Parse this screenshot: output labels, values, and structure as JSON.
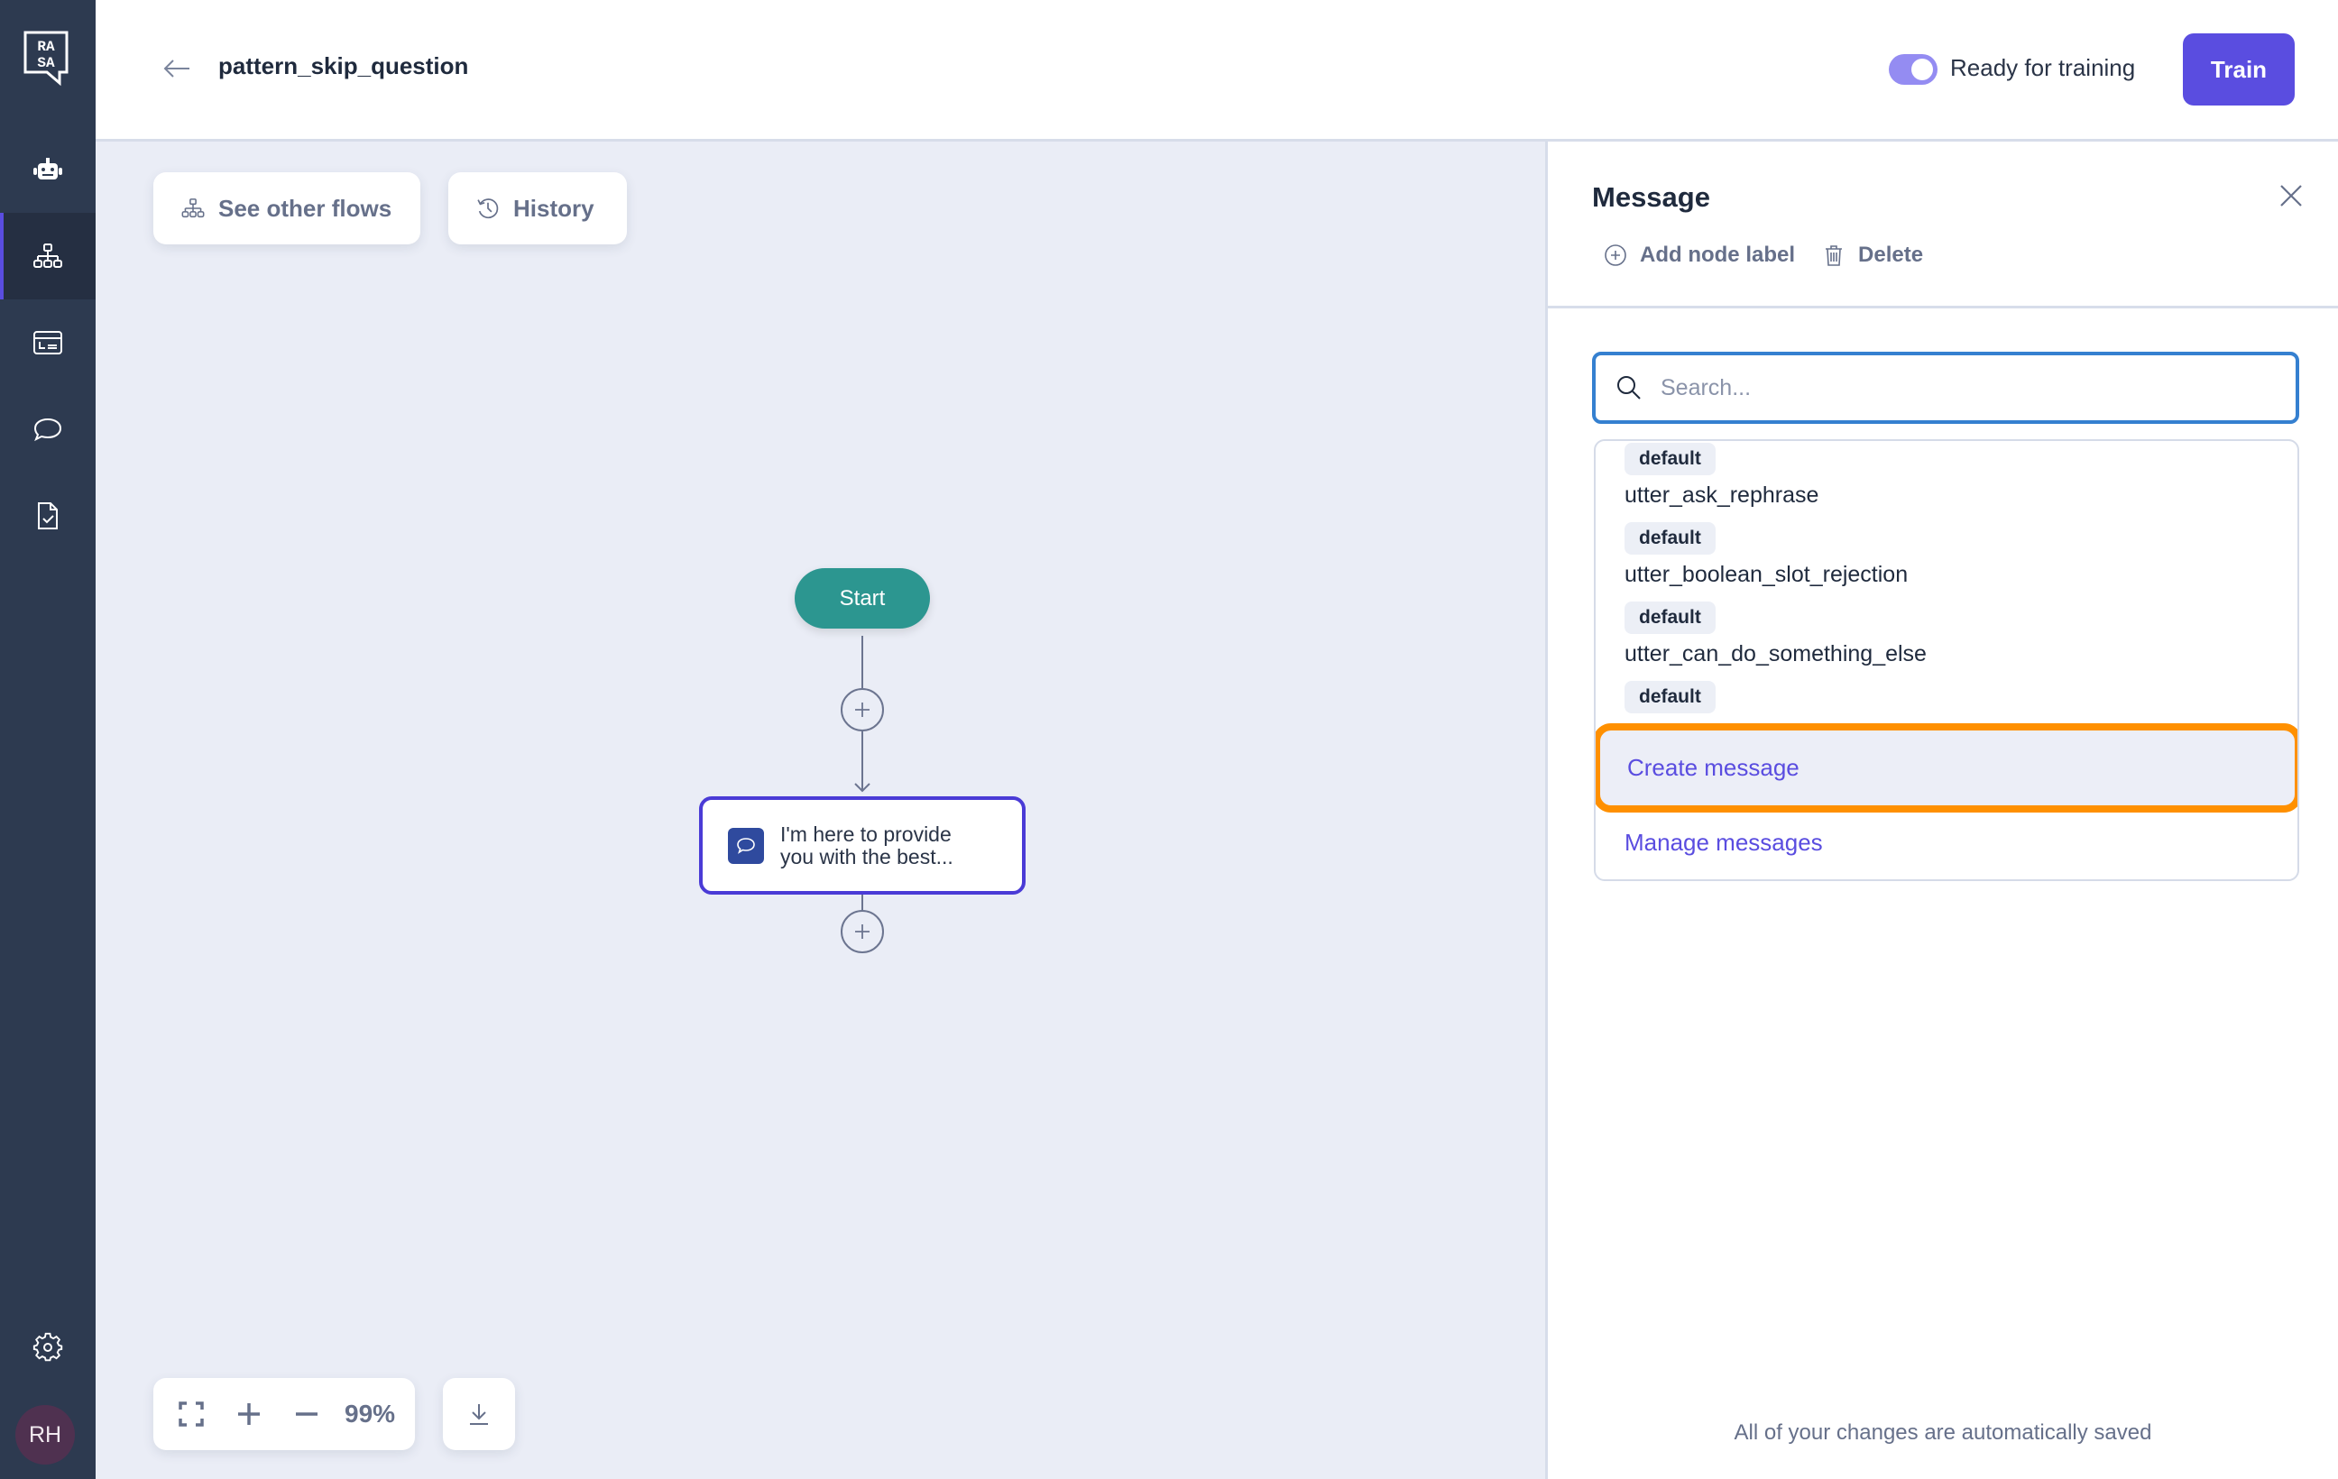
{
  "sidebar": {
    "logo": "rasa-logo",
    "items": [
      {
        "name": "assistant",
        "icon": "robot-icon"
      },
      {
        "name": "flows",
        "icon": "flow-tree-icon",
        "active": true
      },
      {
        "name": "content",
        "icon": "cms-card-icon"
      },
      {
        "name": "conversations",
        "icon": "chat-bubble-icon"
      },
      {
        "name": "reviews",
        "icon": "document-check-icon"
      }
    ],
    "settings_icon": "gear-icon",
    "avatar_initials": "RH"
  },
  "header": {
    "back_icon": "arrow-left-icon",
    "title": "pattern_skip_question",
    "toggle_label": "Ready for training",
    "toggle_on": true,
    "train_label": "Train"
  },
  "canvas": {
    "see_other_flows_label": "See other flows",
    "history_label": "History",
    "start_label": "Start",
    "message_node_text": "I'm here to provide you with the best...",
    "zoom_level": "99%"
  },
  "panel": {
    "title": "Message",
    "add_node_label": "Add node label",
    "delete_label": "Delete",
    "search_placeholder": "Search...",
    "search_value": "",
    "items": [
      {
        "badge": "default",
        "name": "utter_ask_rephrase"
      },
      {
        "badge": "default",
        "name": "utter_boolean_slot_rejection"
      },
      {
        "badge": "default",
        "name": "utter_can_do_something_else"
      },
      {
        "badge": "default",
        "name": ""
      }
    ],
    "create_message_label": "Create message",
    "manage_messages_label": "Manage messages",
    "autosave_text": "All of your changes are automatically saved"
  },
  "colors": {
    "sidebar_bg": "#2d3a50",
    "accent": "#5a4de0",
    "start_node": "#2c9690",
    "highlight": "#ff9000",
    "search_border": "#3580d0"
  }
}
